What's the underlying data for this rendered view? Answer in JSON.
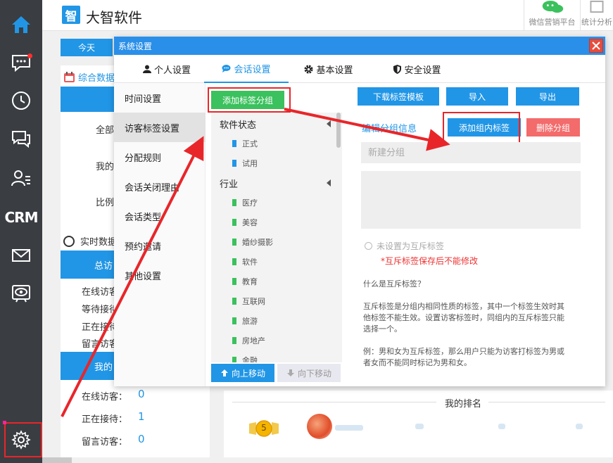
{
  "app": {
    "logo_char": "智",
    "title": "大智软件",
    "top_links": [
      "微信营销平台",
      "统计分析"
    ]
  },
  "sidebar": {
    "items": [
      {
        "name": "home-icon"
      },
      {
        "name": "message-icon"
      },
      {
        "name": "clock-icon"
      },
      {
        "name": "chat-icon"
      },
      {
        "name": "contacts-icon"
      },
      {
        "name": "crm",
        "label": "CRM"
      },
      {
        "name": "mail-icon"
      },
      {
        "name": "eye-icon"
      },
      {
        "name": "gear-icon"
      }
    ]
  },
  "background": {
    "today_tab": "今天",
    "comprehensive_title": "综合数据",
    "labels": [
      "全部",
      "我的",
      "比例"
    ],
    "realtime_title": "实时数据",
    "total_bar": "总访",
    "rows": [
      "在线访客",
      "等待接待",
      "正在接待",
      "留言访客"
    ],
    "mine_bar": "我的",
    "my_rows": [
      {
        "label": "在线访客：",
        "value": "0"
      },
      {
        "label": "正在接待：",
        "value": "1"
      },
      {
        "label": "留言访客：",
        "value": "0"
      }
    ],
    "ranking_title": "我的排名",
    "medal_value": "5"
  },
  "modal": {
    "title": "系统设置",
    "tabs": [
      {
        "label": "个人设置",
        "icon": "user-icon"
      },
      {
        "label": "会话设置",
        "icon": "chat-bubble-icon",
        "active": true
      },
      {
        "label": "基本设置",
        "icon": "gear-icon"
      },
      {
        "label": "安全设置",
        "icon": "shield-icon"
      }
    ],
    "menu": [
      "时间设置",
      "访客标签设置",
      "分配规则",
      "会话关闭理由",
      "会话类型",
      "预约邀请",
      "其他设置"
    ],
    "active_menu_index": 1,
    "buttons": {
      "add_group": "添加标签分组",
      "download_template": "下载标签模板",
      "import": "导入",
      "export": "导出",
      "add_tag": "添加组内标签",
      "delete_group": "删除分组",
      "move_up": "向上移动",
      "move_down": "向下移动"
    },
    "tag_groups": [
      {
        "name": "软件状态",
        "tags": [
          "正式",
          "试用"
        ],
        "color": "#2196e6"
      },
      {
        "name": "行业",
        "tags": [
          "医疗",
          "美容",
          "婚纱摄影",
          "软件",
          "教育",
          "互联网",
          "旅游",
          "房地产",
          "金融"
        ],
        "color": "#3bc15d"
      }
    ],
    "group_info_title": "编辑分组信息",
    "group_name_placeholder": "新建分组",
    "mutex_option": "未设置为互斥标签",
    "mutex_warning": "*互斥标签保存后不能修改",
    "help_question": "什么是互斥标签？",
    "help_body": "互斥标签是分组内相同性质的标签，其中一个标签生效时其他标签不能生效。设置访客标签时，同组内的互斥标签只能选择一个。",
    "help_example": "例：男和女为互斥标签，那么用户只能为访客打标签为男或者女而不能同时标记为男和女。"
  },
  "colors": {
    "sidebar": "#3a3d42",
    "primary": "#2196e6",
    "green": "#3bc15d",
    "red_button": "#f36b6b",
    "annotation_red": "#e8262a"
  }
}
